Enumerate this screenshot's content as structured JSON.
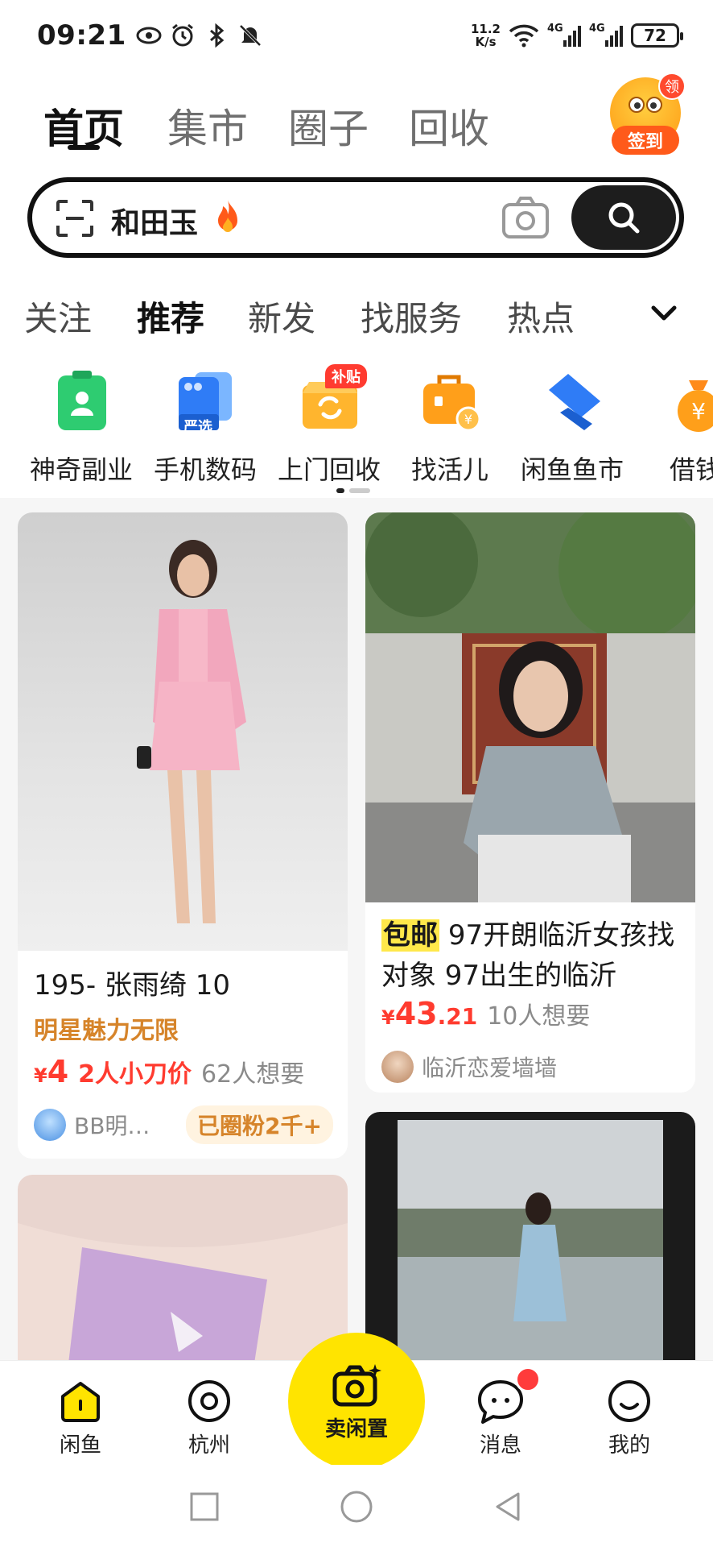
{
  "status_bar": {
    "time": "09:21",
    "net_speed_value": "11.2",
    "net_speed_unit": "K/s",
    "signal1": "4G",
    "signal2": "4G",
    "battery": "72"
  },
  "top_nav": {
    "tabs": [
      "首页",
      "集市",
      "圈子",
      "回收"
    ],
    "active_tab": "首页",
    "signin_label": "签到",
    "signin_badge": "领"
  },
  "search": {
    "query": "和田玉"
  },
  "category_tabs": {
    "items": [
      "关注",
      "推荐",
      "新发",
      "找服务",
      "热点"
    ],
    "active": "推荐"
  },
  "services": [
    {
      "label": "神奇副业",
      "icon": "id-card-icon"
    },
    {
      "label": "手机数码",
      "icon": "phone-icon",
      "sub": "严选"
    },
    {
      "label": "上门回收",
      "icon": "recycle-box-icon",
      "badge": "补贴"
    },
    {
      "label": "找活儿",
      "icon": "briefcase-icon"
    },
    {
      "label": "闲鱼鱼市",
      "icon": "fish-market-icon"
    },
    {
      "label": "借钱",
      "icon": "money-bag-icon"
    }
  ],
  "feed": {
    "card1": {
      "title": "195-  张雨绮   10",
      "brand": "明星魅力无限",
      "price_symbol": "¥",
      "price": "4",
      "discount": "2人小刀价",
      "wants": "62人想要",
      "seller": "BB明…",
      "fans_badge": "已圈粉2千+"
    },
    "card2": {
      "tag": "包邮",
      "title": "97开朗临沂女孩找对象 97出生的临沂",
      "price_symbol": "¥",
      "price_int": "43",
      "price_dec": ".21",
      "wants": "10人想要",
      "seller": "临沂恋爱墙墙"
    }
  },
  "bottom_nav": {
    "items": [
      "闲鱼",
      "杭州",
      "消息",
      "我的"
    ],
    "sell_label": "卖闲置"
  },
  "colors": {
    "brand_yellow": "#ffe400",
    "price_red": "#ff3b2f",
    "brand_orange": "#d6842a"
  }
}
